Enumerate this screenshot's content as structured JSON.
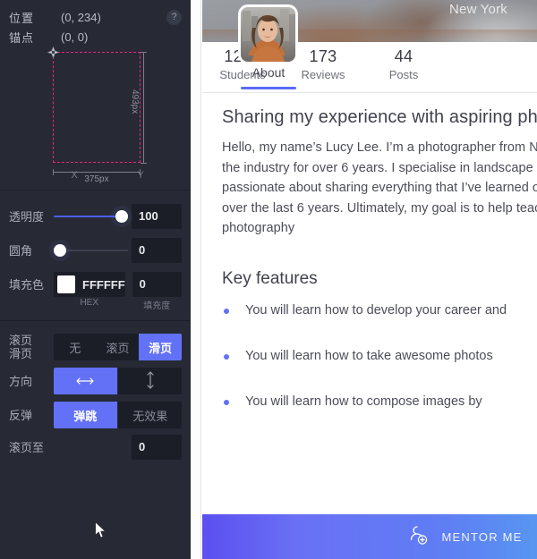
{
  "inspector": {
    "position_label": "位置",
    "position_value": "(0, 234)",
    "anchor_label": "锚点",
    "anchor_value": "(0, 0)",
    "help_glyph": "?",
    "measure": {
      "width_label": "375px",
      "height_label": "493px"
    },
    "axis": {
      "x": "X",
      "y": "Y"
    },
    "opacity": {
      "label": "透明度",
      "value": "100",
      "slider_percent": 100
    },
    "radius": {
      "label": "圆角",
      "value": "0",
      "slider_percent": 0
    },
    "fill": {
      "label": "填充色",
      "hex": "FFFFFF",
      "swatch_color": "#FFFFFF",
      "hex_sub_label": "HEX",
      "opacity_value": "0",
      "opacity_sub_label": "填充度"
    },
    "scroll_mode": {
      "label": "滚页\n滑页",
      "label_line1": "滚页",
      "label_line2": "滑页",
      "options": [
        "无",
        "滚页",
        "滑页"
      ],
      "selected": "滑页"
    },
    "direction": {
      "label": "方向",
      "options": [
        "horizontal-arrow",
        "vertical-arrow"
      ],
      "selected": "horizontal-arrow"
    },
    "bounce": {
      "label": "反弹",
      "options": [
        "弹跳",
        "无效果"
      ],
      "selected": "弹跳"
    },
    "scroll_to": {
      "label": "滚页至",
      "value": "0"
    },
    "accent_color": "#6271F6",
    "selection_color": "#E8247E"
  },
  "preview": {
    "hero_title": "New York",
    "tab_about": "About",
    "stats": [
      {
        "number": "1225",
        "label": "Students"
      },
      {
        "number": "173",
        "label": "Reviews"
      },
      {
        "number": "44",
        "label": "Posts"
      }
    ],
    "heading": "Sharing my experience with aspiring photographers",
    "paragraph": "Hello, my name’s Lucy Lee. I’m a photographer from New York, and have been in the industry for over 6 years. I specialise in landscape photography, and am passionate about sharing everything that I’ve learned on my photographic journey over the last 6 years. Ultimately, my goal is to help teach you everything about photography",
    "features_heading": "Key features",
    "features": [
      "You will learn how to develop your career and",
      "You will learn how to take awesome photos",
      "You will learn how to compose images by"
    ],
    "cta_label": "MENTOR ME"
  }
}
